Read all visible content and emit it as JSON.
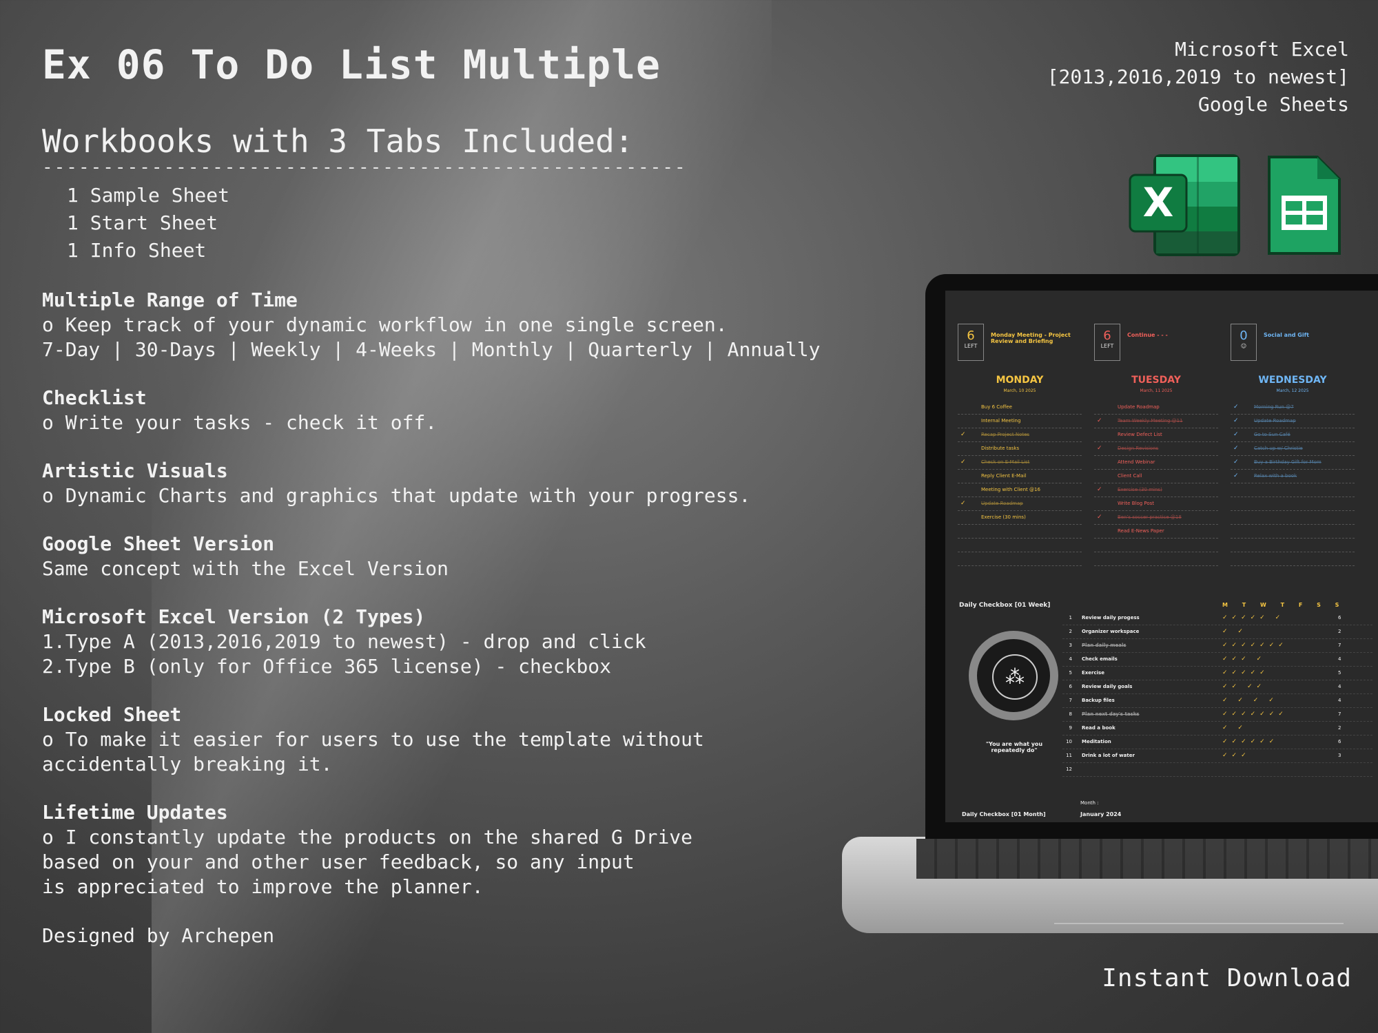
{
  "title": "Ex 06 To Do List Multiple",
  "subtitle": "Workbooks with 3 Tabs Included:",
  "rule": "-----------------------------------------------------",
  "tabs": [
    "1 Sample Sheet",
    "1 Start Sheet",
    "1 Info Sheet"
  ],
  "sections": [
    {
      "heading": "Multiple Range of Time",
      "lines": [
        "o Keep track of your dynamic workflow in one single screen.",
        "7-Day | 30-Days | Weekly | 4-Weeks | Monthly | Quarterly | Annually"
      ]
    },
    {
      "heading": "Checklist",
      "lines": [
        "o Write your tasks - check it off."
      ]
    },
    {
      "heading": "Artistic Visuals",
      "lines": [
        "o Dynamic Charts and graphics that update with your progress."
      ]
    },
    {
      "heading": "Google Sheet Version",
      "lines": [
        "Same concept with the Excel Version"
      ]
    },
    {
      "heading": "Microsoft Excel Version (2 Types)",
      "lines": [
        "1.Type A (2013,2016,2019 to newest) - drop and click",
        "2.Type B (only for Office 365 license) - checkbox"
      ]
    },
    {
      "heading": "Locked Sheet",
      "lines": [
        "o To make it easier for users to use the template without",
        "accidentally breaking it."
      ]
    },
    {
      "heading": "Lifetime Updates",
      "lines": [
        "o I constantly update the products on the shared G Drive",
        "based on your and other user feedback, so any input",
        "is appreciated to improve the planner."
      ]
    }
  ],
  "designed_by": "Designed by Archepen",
  "platforms": [
    "Microsoft Excel",
    "[2013,2016,2019 to newest]",
    "Google Sheets"
  ],
  "instant_download": "Instant Download",
  "icons": {
    "excel": "excel-logo-icon",
    "sheets": "google-sheets-logo-icon"
  },
  "colors": {
    "monday": "#f5c542",
    "tuesday": "#f0605a",
    "wednesday": "#6fb6f5",
    "excel_green": "#1f7a45",
    "sheets_green": "#1ea362"
  },
  "screen": {
    "days": [
      {
        "left_count": "6",
        "left_label": "LEFT",
        "note": "Monday Meeting - Project Review and Briefing",
        "name": "MONDAY",
        "date": "March, 10 2025",
        "tasks": [
          {
            "text": "Buy 6 Coffee",
            "done": false
          },
          {
            "text": "Internal Meeting",
            "done": false
          },
          {
            "text": "Recap Project Notes",
            "done": true
          },
          {
            "text": "Distribute tasks",
            "done": false
          },
          {
            "text": "Check on E-Mail List",
            "done": true
          },
          {
            "text": "Reply Client E-Mail",
            "done": false
          },
          {
            "text": "Meeting with Client @16",
            "done": false
          },
          {
            "text": "Update Roadmap",
            "done": true
          },
          {
            "text": "Exercise (30 mins)",
            "done": false
          }
        ]
      },
      {
        "left_count": "6",
        "left_label": "LEFT",
        "note": "Continue - - -",
        "name": "TUESDAY",
        "date": "March, 11 2025",
        "tasks": [
          {
            "text": "Update Roadmap",
            "done": false
          },
          {
            "text": "Team Weekly Meeting @11",
            "done": true
          },
          {
            "text": "Review Defect List",
            "done": false
          },
          {
            "text": "Design Revisions",
            "done": true
          },
          {
            "text": "Attend Webinar",
            "done": false
          },
          {
            "text": "Client Call",
            "done": false
          },
          {
            "text": "Exercise (30 mins)",
            "done": true
          },
          {
            "text": "Write Blog Post",
            "done": false
          },
          {
            "text": "Ben's soccer practice @18",
            "done": true
          },
          {
            "text": "Read E-News Paper",
            "done": false
          }
        ]
      },
      {
        "left_count": "0",
        "left_label": "",
        "note": "Social and Gift",
        "name": "WEDNESDAY",
        "date": "March, 12 2025",
        "tasks": [
          {
            "text": "Morning Run @7",
            "done": true
          },
          {
            "text": "Update Roadmap",
            "done": true
          },
          {
            "text": "Go to Sun Café",
            "done": true
          },
          {
            "text": "Catch up w/ Christie",
            "done": true
          },
          {
            "text": "Buy a Birthday Gift for Mom",
            "done": true
          },
          {
            "text": "Relax with a book",
            "done": true
          }
        ]
      }
    ],
    "weekly_header": "Daily Checkbox [01 Week]",
    "weekdays": "M T W T F S S",
    "quote": "\"You are what you repeatedly do\"",
    "habits": [
      {
        "num": "1",
        "label": "Review daily progess",
        "marks": "✓✓✓✓✓ ✓",
        "count": "6"
      },
      {
        "num": "2",
        "label": "Organizer workspace",
        "marks": "✓ ✓",
        "count": "2"
      },
      {
        "num": "3",
        "label": "Plan daily meals",
        "marks": "✓✓✓✓✓✓✓",
        "count": "7"
      },
      {
        "num": "4",
        "label": "Check emails",
        "marks": "✓✓✓ ✓",
        "count": "4"
      },
      {
        "num": "5",
        "label": "Exercise",
        "marks": "✓✓✓✓✓",
        "count": "5"
      },
      {
        "num": "6",
        "label": "Review daily goals",
        "marks": "✓✓    ✓✓",
        "count": "4"
      },
      {
        "num": "7",
        "label": "Backup files",
        "marks": "✓ ✓  ✓ ✓",
        "count": "4"
      },
      {
        "num": "8",
        "label": "Plan next day's tasks",
        "marks": "✓✓✓✓✓✓✓",
        "count": "7"
      },
      {
        "num": "9",
        "label": "Read a book",
        "marks": "✓     ✓",
        "count": "2"
      },
      {
        "num": "10",
        "label": "Meditation",
        "marks": "✓✓✓✓✓✓",
        "count": "6"
      },
      {
        "num": "11",
        "label": "Drink a lot of water",
        "marks": "✓✓✓",
        "count": "3"
      },
      {
        "num": "12",
        "label": "",
        "marks": "",
        "count": ""
      }
    ],
    "month_header": "Daily Checkbox [01 Month]",
    "month_label": "Month :",
    "month_value": "January 2024"
  }
}
